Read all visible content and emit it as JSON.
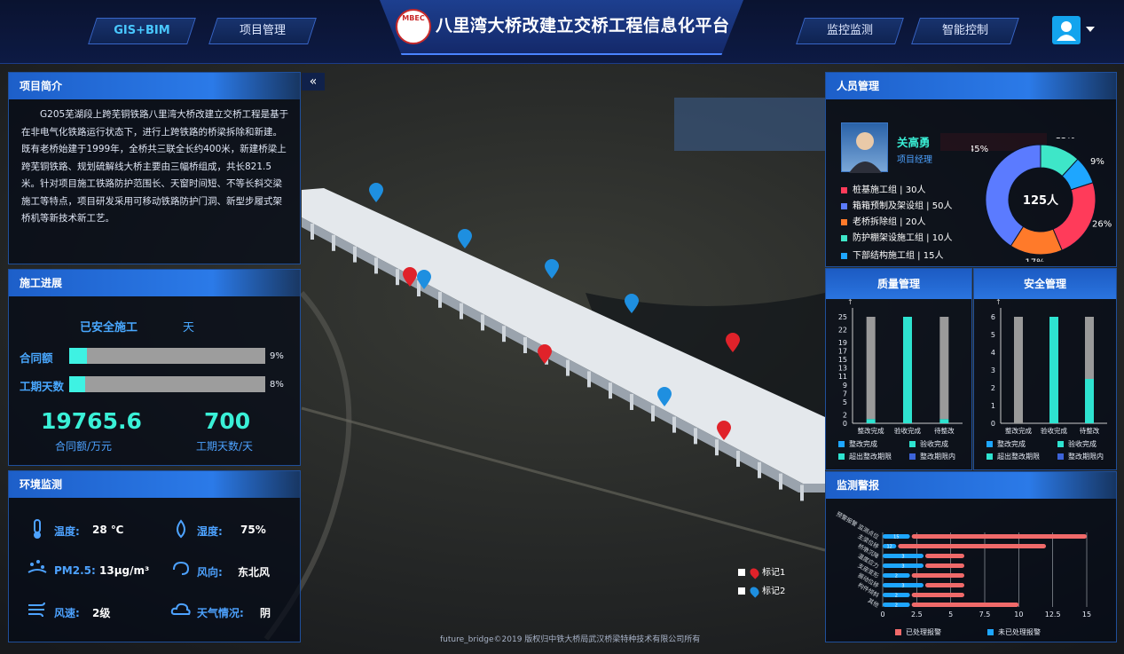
{
  "header": {
    "title": "八里湾大桥改建立交桥工程信息化平台",
    "logo_text": "MBEC",
    "nav_left": [
      "GIS+BIM",
      "项目管理"
    ],
    "nav_right": [
      "监控监测",
      "智能控制"
    ],
    "active_nav": "GIS+BIM"
  },
  "intro": {
    "title": "项目简介",
    "text": "G205芜湖段上跨芜铜铁路八里湾大桥改建立交桥工程是基于在非电气化铁路运行状态下，进行上跨铁路的桥梁拆除和新建。既有老桥始建于1999年，全桥共三联全长约400米，新建桥梁上跨芜铜铁路、规划硫解线大桥主要由三幅桥组成，共长821.5米。针对项目施工铁路防护范围长、天窗时间短、不等长斜交梁施工等特点，项目研发采用可移动铁路防护门洞、新型步履式架桥机等新技术新工艺。"
  },
  "progress": {
    "title": "施工进展",
    "safe_label": "已安全施工",
    "safe_unit": "天",
    "rows": [
      {
        "label": "合同额",
        "percent": 9,
        "percent_text": "9%"
      },
      {
        "label": "工期天数",
        "percent": 8,
        "percent_text": "8%"
      }
    ],
    "contract_value": "19765.6",
    "contract_caption": "合同额/万元",
    "days_value": "700",
    "days_caption": "工期天数/天"
  },
  "environment": {
    "title": "环境监测",
    "items": [
      {
        "label": "温度:",
        "value": "28 ℃",
        "icon": "thermometer-icon"
      },
      {
        "label": "湿度:",
        "value": "75%",
        "icon": "humidity-icon"
      },
      {
        "label": "PM2.5:",
        "value": "13μg/m³",
        "icon": "dust-icon"
      },
      {
        "label": "风向:",
        "value": "东北风",
        "icon": "wind-direction-icon"
      },
      {
        "label": "风速:",
        "value": "2级",
        "icon": "wind-speed-icon"
      },
      {
        "label": "天气情况:",
        "value": "阴",
        "icon": "weather-cloud-icon"
      }
    ]
  },
  "map_legend": {
    "items": [
      {
        "label": "标记1",
        "color": "#e0222a"
      },
      {
        "label": "标记2",
        "color": "#1e8fe0"
      }
    ]
  },
  "copyright": "future_bridge©2019 版权归中铁大桥局武汉桥梁特种技术有限公司所有",
  "personnel": {
    "title": "人员管理",
    "name": "关高勇",
    "role": "项目经理",
    "total": "125人",
    "teams": [
      {
        "label": "桩基施工组 | 30人",
        "color": "#ff3b5a"
      },
      {
        "label": "箱箱预制及架设组 | 50人",
        "color": "#5b7bff"
      },
      {
        "label": "老桥拆除组 | 20人",
        "color": "#ff7a2a"
      },
      {
        "label": "防护棚架设施工组 | 10人",
        "color": "#3ee6c8"
      },
      {
        "label": "下部结构施工组 | 15人",
        "color": "#1ea6ff"
      }
    ]
  },
  "chart_data": [
    {
      "type": "pie",
      "labels": [
        "45%",
        "13%",
        "9%",
        "26%",
        "17%"
      ],
      "values": [
        45,
        13,
        9,
        26,
        17
      ],
      "colors": [
        "#5b7bff",
        "#3ee6c8",
        "#1ea6ff",
        "#ff3b5a",
        "#ff7a2a"
      ],
      "center_label": "125人"
    },
    {
      "type": "bar",
      "title": "质量管理",
      "categories": [
        "整改完成",
        "验收完成",
        "待整改"
      ],
      "yticks": [
        "0",
        "2",
        "5",
        "7",
        "9",
        "11",
        "13",
        "15",
        "17",
        "19",
        "22",
        "25"
      ],
      "ylim": [
        0,
        25
      ],
      "series": [
        {
          "values": [
            24,
            0,
            24
          ],
          "color": "#9a9a9a"
        },
        {
          "values": [
            1,
            25,
            1
          ],
          "color": "#2ee3d0"
        }
      ],
      "legend": [
        "整改完成",
        "验收完成",
        "超出整改期限",
        "整改期限内"
      ],
      "legend_colors": [
        "#1ea6ff",
        "#2ee3d0",
        "#2ee3d0",
        "#3c63d9"
      ]
    },
    {
      "type": "bar",
      "title": "安全管理",
      "categories": [
        "整改完成",
        "验收完成",
        "待整改"
      ],
      "yticks": [
        "0",
        "1",
        "2",
        "3",
        "4",
        "5",
        "6"
      ],
      "ylim": [
        0,
        6
      ],
      "series": [
        {
          "values": [
            6,
            0,
            3.5
          ],
          "color": "#9a9a9a"
        },
        {
          "values": [
            0,
            6,
            2.5
          ],
          "color": "#2ee3d0"
        }
      ],
      "legend": [
        "整改完成",
        "验收完成",
        "超出整改期限",
        "整改期限内"
      ],
      "legend_colors": [
        "#1ea6ff",
        "#2ee3d0",
        "#2ee3d0",
        "#3c63d9"
      ]
    },
    {
      "type": "bar",
      "title": "监测警报",
      "orientation": "horizontal",
      "categories": [
        "预警报警 监测点位",
        "主梁位移",
        "桥墩沉降",
        "温度应力",
        "支座变形",
        "振动位移",
        "构件倾斜",
        "其他"
      ],
      "xticks": [
        "0",
        "2.5",
        "5",
        "7.5",
        "10",
        "12.5",
        "15"
      ],
      "xlim": [
        0,
        15
      ],
      "series": [
        {
          "name": "已处理报警",
          "values": [
            15,
            12,
            6,
            6,
            6,
            6,
            6,
            10
          ],
          "color": "#f06a6a"
        },
        {
          "name": "未已处理报警",
          "values": [
            2,
            1,
            3,
            3,
            2,
            3,
            2,
            2
          ],
          "color": "#1ea6ff"
        }
      ],
      "data_labels": [
        "15",
        "12",
        "3",
        "3",
        "2",
        "3",
        "2",
        "2"
      ]
    }
  ],
  "quality": {
    "title": "质量管理"
  },
  "safety": {
    "title": "安全管理"
  },
  "alarm": {
    "title": "监测警报",
    "legend": [
      "已处理报警",
      "未已处理报警"
    ]
  }
}
